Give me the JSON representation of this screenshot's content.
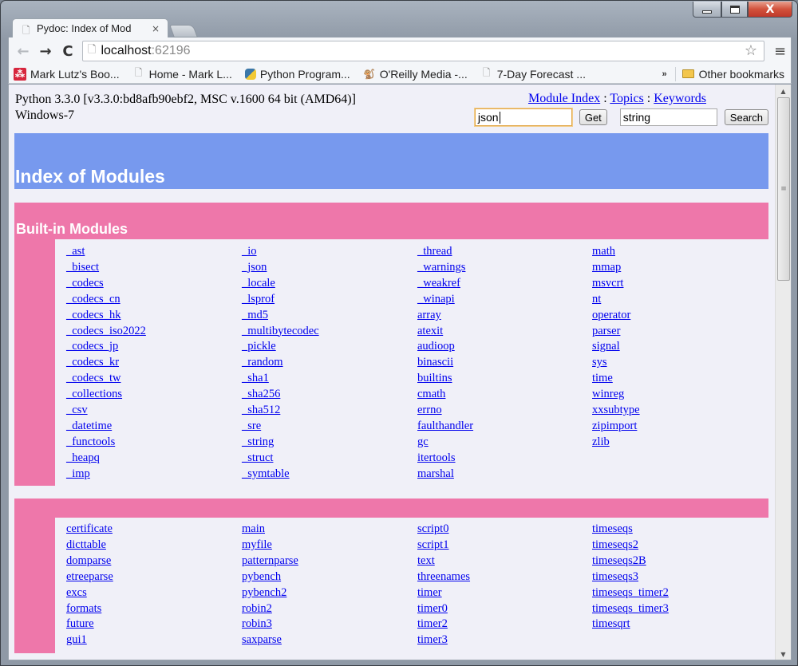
{
  "window": {
    "minimize_label": "",
    "maximize_label": "",
    "close_label": "X"
  },
  "tabs": [
    {
      "title": "Pydoc: Index of Mod",
      "active": true,
      "close": "×"
    }
  ],
  "toolbar": {
    "back_icon": "←",
    "forward_icon": "→",
    "reload_icon": "C",
    "url_host": "localhost",
    "url_port": ":62196",
    "star_icon": "☆",
    "menu_icon": "≡"
  },
  "bookmarks": {
    "items": [
      {
        "label": "Mark Lutz's Boo...",
        "icon": "oreilly-icon"
      },
      {
        "label": "Home - Mark L...",
        "icon": "page-icon"
      },
      {
        "label": "Python Program...",
        "icon": "python-icon"
      },
      {
        "label": "O'Reilly Media -...",
        "icon": "tarsier-icon"
      },
      {
        "label": "7-Day Forecast ...",
        "icon": "page-icon"
      }
    ],
    "overflow": "»",
    "other": "Other bookmarks"
  },
  "page": {
    "sysinfo_line1": "Python 3.3.0 [v3.3.0:bd8afb90ebf2, MSC v.1600 64 bit (AMD64)]",
    "sysinfo_line2": "Windows-7",
    "links": {
      "module_index": "Module Index",
      "topics": "Topics",
      "keywords": "Keywords",
      "separator": " : "
    },
    "get_field_value": "json",
    "get_button": "Get",
    "search_field_value": "string",
    "search_button": "Search",
    "title": "Index of Modules",
    "sections": [
      {
        "heading": "Built-in Modules",
        "columns": [
          [
            "_ast",
            "_bisect",
            "_codecs",
            "_codecs_cn",
            "_codecs_hk",
            "_codecs_iso2022",
            "_codecs_jp",
            "_codecs_kr",
            "_codecs_tw",
            "_collections",
            "_csv",
            "_datetime",
            "_functools",
            "_heapq",
            "_imp"
          ],
          [
            "_io",
            "_json",
            "_locale",
            "_lsprof",
            "_md5",
            "_multibytecodec",
            "_pickle",
            "_random",
            "_sha1",
            "_sha256",
            "_sha512",
            "_sre",
            "_string",
            "_struct",
            "_symtable"
          ],
          [
            "_thread",
            "_warnings",
            "_weakref",
            "_winapi",
            "array",
            "atexit",
            "audioop",
            "binascii",
            "builtins",
            "cmath",
            "errno",
            "faulthandler",
            "gc",
            "itertools",
            "marshal"
          ],
          [
            "math",
            "mmap",
            "msvcrt",
            "nt",
            "operator",
            "parser",
            "signal",
            "sys",
            "time",
            "winreg",
            "xxsubtype",
            "zipimport",
            "zlib"
          ]
        ]
      },
      {
        "heading": "",
        "columns": [
          [
            "certificate",
            "dicttable",
            "domparse",
            "etreeparse",
            "excs",
            "formats",
            "future",
            "gui1"
          ],
          [
            "main",
            "myfile",
            "patternparse",
            "pybench",
            "pybench2",
            "robin2",
            "robin3",
            "saxparse"
          ],
          [
            "script0",
            "script1",
            "text",
            "threenames",
            "timer",
            "timer0",
            "timer2",
            "timer3"
          ],
          [
            "timeseqs",
            "timeseqs2",
            "timeseqs2B",
            "timeseqs3",
            "timeseqs_timer2",
            "timeseqs_timer3",
            "timesqrt"
          ]
        ]
      }
    ]
  },
  "colors": {
    "title_banner": "#7799ee",
    "section_banner": "#ee77aa",
    "page_bg": "#f0f0f8",
    "link": "#0000ee"
  }
}
